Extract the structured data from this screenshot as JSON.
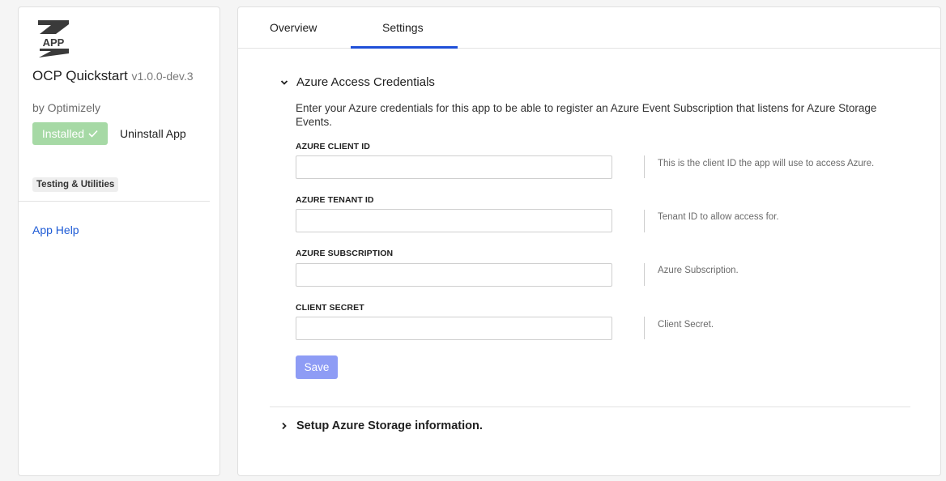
{
  "app": {
    "logo_text": "APP",
    "name": "OCP Quickstart",
    "version": "v1.0.0-dev.3",
    "vendor": "by Optimizely",
    "installed_label": "Installed",
    "uninstall_label": "Uninstall App",
    "category": "Testing & Utilities",
    "help_label": "App Help"
  },
  "tabs": [
    {
      "label": "Overview",
      "active": false
    },
    {
      "label": "Settings",
      "active": true
    }
  ],
  "sections": [
    {
      "title": "Azure Access Credentials",
      "expanded": true,
      "description": "Enter your Azure credentials for this app to be able to register an Azure Event Subscription that listens for Azure Storage Events.",
      "fields": [
        {
          "label": "AZURE CLIENT ID",
          "value": "",
          "help": "This is the client ID the app will use to access Azure."
        },
        {
          "label": "AZURE TENANT ID",
          "value": "",
          "help": "Tenant ID to allow access for."
        },
        {
          "label": "AZURE SUBSCRIPTION",
          "value": "",
          "help": "Azure Subscription."
        },
        {
          "label": "CLIENT SECRET",
          "value": "",
          "help": "Client Secret."
        }
      ],
      "save_label": "Save"
    },
    {
      "title": "Setup Azure Storage information.",
      "expanded": false
    }
  ],
  "colors": {
    "accent": "#1e4fd8",
    "installed": "#a6d9a5",
    "save_disabled": "#8e9cf5",
    "link": "#1e5bd6"
  },
  "icons": [
    "app-logo-icon",
    "check-icon",
    "chevron-down-icon",
    "chevron-right-icon"
  ]
}
